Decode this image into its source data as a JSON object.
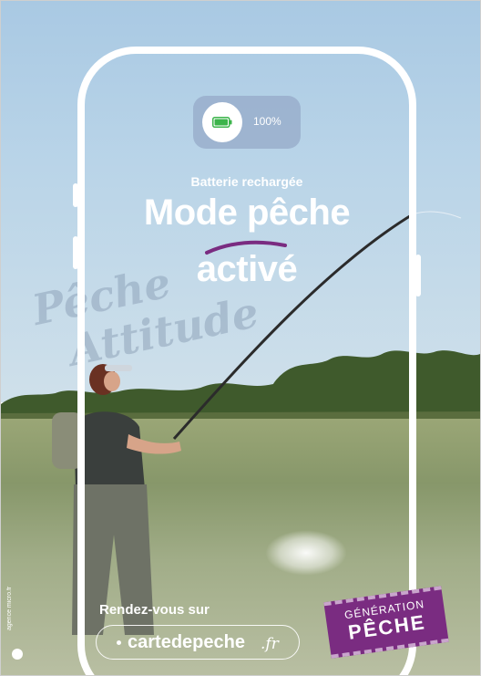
{
  "battery": {
    "percent_label": "100%",
    "level": 1.0
  },
  "headline": {
    "subtitle": "Batterie rechargée",
    "line1": "Mode pêche",
    "line2": "activé"
  },
  "watermark": {
    "line1": "Pêche",
    "line2": "Attitude"
  },
  "cta": {
    "label": "Rendez-vous sur",
    "url_main": "cartedepeche",
    "url_suffix": ".fr"
  },
  "badge": {
    "line1": "GÉNÉRATION",
    "line2": "PÊCHE"
  },
  "credit": {
    "text": "agence micro.fr"
  },
  "colors": {
    "brand_purple": "#7a2c81",
    "battery_green": "#3cb44b",
    "frame_white": "#ffffff"
  }
}
